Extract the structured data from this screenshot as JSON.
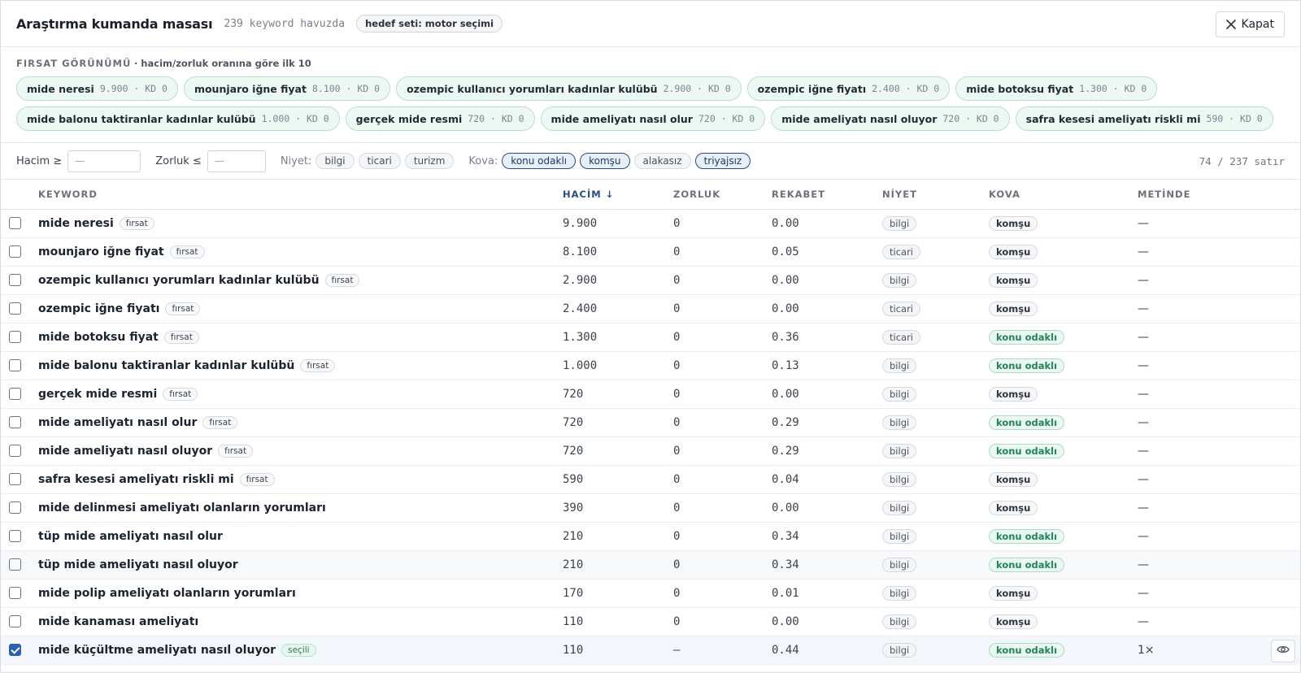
{
  "header": {
    "title": "Araştırma kumanda masası",
    "pool_count": "239 keyword havuzda",
    "target_set": "hedef seti: motor seçimi",
    "close_label": "Kapat"
  },
  "opportunity_view": {
    "label": "FIRSAT GÖRÜNÜMÜ",
    "note": "· hacim/zorluk oranına göre ilk 10",
    "chips": [
      {
        "keyword": "mide neresi",
        "meta": "9.900 · KD 0"
      },
      {
        "keyword": "mounjaro iğne fiyat",
        "meta": "8.100 · KD 0"
      },
      {
        "keyword": "ozempic kullanıcı yorumları kadınlar kulübü",
        "meta": "2.900 · KD 0"
      },
      {
        "keyword": "ozempic iğne fiyatı",
        "meta": "2.400 · KD 0"
      },
      {
        "keyword": "mide botoksu fiyat",
        "meta": "1.300 · KD 0"
      },
      {
        "keyword": "mide balonu taktiranlar kadınlar kulübü",
        "meta": "1.000 · KD 0"
      },
      {
        "keyword": "gerçek mide resmi",
        "meta": "720 · KD 0"
      },
      {
        "keyword": "mide ameliyatı nasıl olur",
        "meta": "720 · KD 0"
      },
      {
        "keyword": "mide ameliyatı nasıl oluyor",
        "meta": "720 · KD 0"
      },
      {
        "keyword": "safra kesesi ameliyatı riskli mi",
        "meta": "590 · KD 0"
      }
    ]
  },
  "filters": {
    "volume_label": "Hacim ≥",
    "volume_placeholder": "—",
    "difficulty_label": "Zorluk ≤",
    "difficulty_placeholder": "—",
    "intent_label": "Niyet:",
    "intents": [
      {
        "label": "bilgi",
        "active": false
      },
      {
        "label": "ticari",
        "active": false
      },
      {
        "label": "turizm",
        "active": false
      }
    ],
    "bucket_label": "Kova:",
    "buckets": [
      {
        "label": "konu odaklı",
        "active": true
      },
      {
        "label": "komşu",
        "active": true
      },
      {
        "label": "alakasız",
        "active": false
      },
      {
        "label": "triyajsız",
        "active": true
      }
    ],
    "row_count": "74 / 237 satır"
  },
  "table": {
    "columns": [
      "KEYWORD",
      "HACİM ↓",
      "ZORLUK",
      "REKABET",
      "NİYET",
      "KOVA",
      "METİNDE"
    ],
    "rows": [
      {
        "checked": false,
        "keyword": "mide neresi",
        "tag": "fırsat",
        "volume": "9.900",
        "difficulty": "0",
        "competition": "0.00",
        "intent": "bilgi",
        "bucket": "komşu",
        "in_text": "—"
      },
      {
        "checked": false,
        "keyword": "mounjaro iğne fiyat",
        "tag": "fırsat",
        "volume": "8.100",
        "difficulty": "0",
        "competition": "0.05",
        "intent": "ticari",
        "bucket": "komşu",
        "in_text": "—"
      },
      {
        "checked": false,
        "keyword": "ozempic kullanıcı yorumları kadınlar kulübü",
        "tag": "fırsat",
        "volume": "2.900",
        "difficulty": "0",
        "competition": "0.00",
        "intent": "bilgi",
        "bucket": "komşu",
        "in_text": "—"
      },
      {
        "checked": false,
        "keyword": "ozempic iğne fiyatı",
        "tag": "fırsat",
        "volume": "2.400",
        "difficulty": "0",
        "competition": "0.00",
        "intent": "ticari",
        "bucket": "komşu",
        "in_text": "—"
      },
      {
        "checked": false,
        "keyword": "mide botoksu fiyat",
        "tag": "fırsat",
        "volume": "1.300",
        "difficulty": "0",
        "competition": "0.36",
        "intent": "ticari",
        "bucket": "konu odaklı",
        "in_text": "—"
      },
      {
        "checked": false,
        "keyword": "mide balonu taktiranlar kadınlar kulübü",
        "tag": "fırsat",
        "volume": "1.000",
        "difficulty": "0",
        "competition": "0.13",
        "intent": "bilgi",
        "bucket": "konu odaklı",
        "in_text": "—"
      },
      {
        "checked": false,
        "keyword": "gerçek mide resmi",
        "tag": "fırsat",
        "volume": "720",
        "difficulty": "0",
        "competition": "0.00",
        "intent": "bilgi",
        "bucket": "komşu",
        "in_text": "—"
      },
      {
        "checked": false,
        "keyword": "mide ameliyatı nasıl olur",
        "tag": "fırsat",
        "volume": "720",
        "difficulty": "0",
        "competition": "0.29",
        "intent": "bilgi",
        "bucket": "konu odaklı",
        "in_text": "—"
      },
      {
        "checked": false,
        "keyword": "mide ameliyatı nasıl oluyor",
        "tag": "fırsat",
        "volume": "720",
        "difficulty": "0",
        "competition": "0.29",
        "intent": "bilgi",
        "bucket": "konu odaklı",
        "in_text": "—"
      },
      {
        "checked": false,
        "keyword": "safra kesesi ameliyatı riskli mi",
        "tag": "fırsat",
        "volume": "590",
        "difficulty": "0",
        "competition": "0.04",
        "intent": "bilgi",
        "bucket": "komşu",
        "in_text": "—"
      },
      {
        "checked": false,
        "keyword": "mide delinmesi ameliyatı olanların yorumları",
        "tag": "",
        "volume": "390",
        "difficulty": "0",
        "competition": "0.00",
        "intent": "bilgi",
        "bucket": "komşu",
        "in_text": "—"
      },
      {
        "checked": false,
        "keyword": "tüp mide ameliyatı nasıl olur",
        "tag": "",
        "volume": "210",
        "difficulty": "0",
        "competition": "0.34",
        "intent": "bilgi",
        "bucket": "konu odaklı",
        "in_text": "—"
      },
      {
        "checked": false,
        "keyword": "tüp mide ameliyatı nasıl oluyor",
        "tag": "",
        "volume": "210",
        "difficulty": "0",
        "competition": "0.34",
        "intent": "bilgi",
        "bucket": "konu odaklı",
        "in_text": "—"
      },
      {
        "checked": false,
        "keyword": "mide polip ameliyatı olanların yorumları",
        "tag": "",
        "volume": "170",
        "difficulty": "0",
        "competition": "0.01",
        "intent": "bilgi",
        "bucket": "komşu",
        "in_text": "—"
      },
      {
        "checked": false,
        "keyword": "mide kanaması ameliyatı",
        "tag": "",
        "volume": "110",
        "difficulty": "0",
        "competition": "0.00",
        "intent": "bilgi",
        "bucket": "komşu",
        "in_text": "—"
      },
      {
        "checked": true,
        "keyword": "mide küçültme ameliyatı nasıl oluyor",
        "tag": "seçili",
        "volume": "110",
        "difficulty": "—",
        "competition": "0.44",
        "intent": "bilgi",
        "bucket": "konu odaklı",
        "in_text": "1×"
      }
    ]
  },
  "icons": {
    "close": "close-icon",
    "preview": "eye-icon"
  },
  "colors": {
    "accent": "#2b4d78",
    "opportunity": "#eef8f3",
    "topic_bucket": "#22845a",
    "checkbox": "#2b5fb0"
  }
}
